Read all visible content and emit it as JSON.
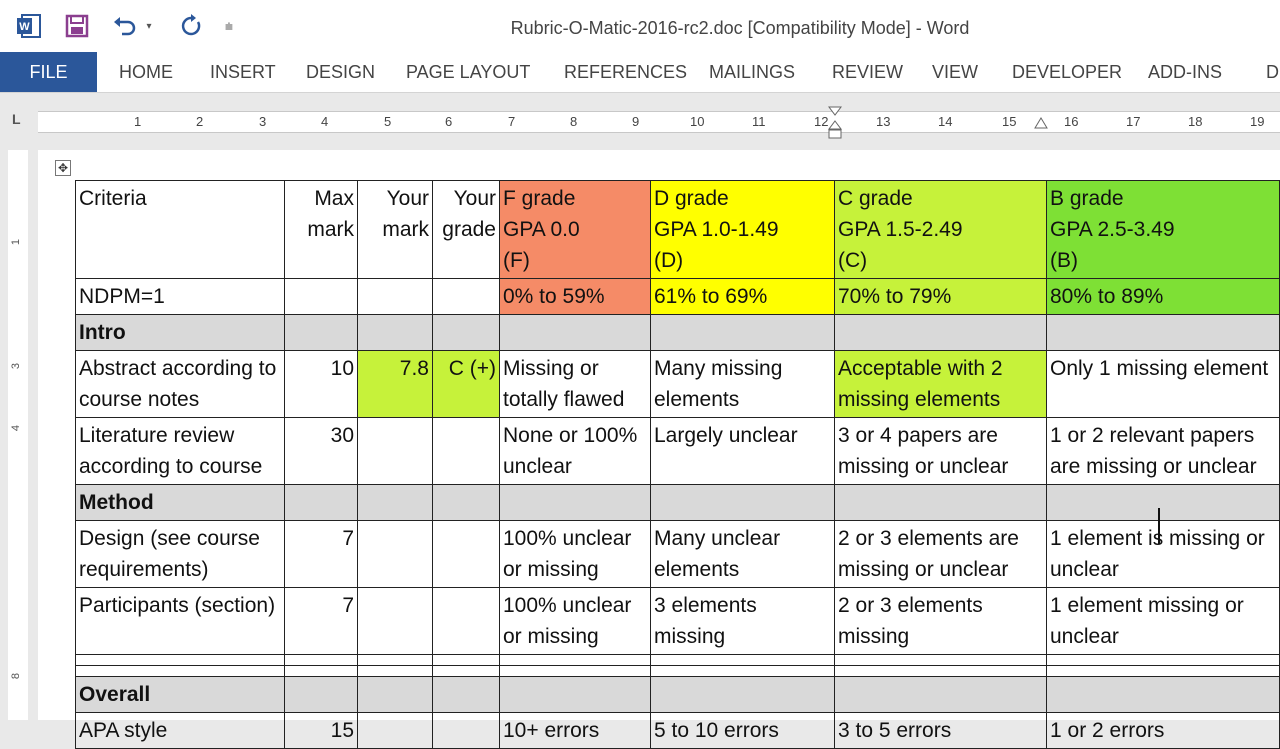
{
  "app": {
    "title": "Rubric-O-Matic-2016-rc2.doc [Compatibility Mode] - Word",
    "icons": [
      "word-icon",
      "save-icon",
      "undo-icon",
      "undo-dropdown-icon",
      "redo-icon",
      "customize-qat-icon"
    ]
  },
  "ribbon": {
    "file": "FILE",
    "tabs": [
      "HOME",
      "INSERT",
      "DESIGN",
      "PAGE LAYOUT",
      "REFERENCES",
      "MAILINGS",
      "REVIEW",
      "VIEW",
      "DEVELOPER",
      "ADD-INS",
      "D"
    ]
  },
  "ruler": {
    "tab_selector": "L",
    "numbers": [
      "1",
      "2",
      "3",
      "4",
      "5",
      "6",
      "7",
      "8",
      "9",
      "10",
      "11",
      "12",
      "13",
      "14",
      "15",
      "16",
      "17",
      "18",
      "19"
    ],
    "vertical_numbers": [
      "1",
      "3",
      "4",
      "8"
    ]
  },
  "table": {
    "header": {
      "criteria": "Criteria",
      "max_mark": [
        "Max",
        "mark"
      ],
      "your_mark": [
        "Your",
        "mark"
      ],
      "your_grade": [
        "Your",
        "grade"
      ],
      "grades": [
        {
          "lines": [
            "F grade",
            "GPA 0.0",
            "(F)"
          ],
          "range": "0% to 59%",
          "color": "#f58b67"
        },
        {
          "lines": [
            "D grade",
            "GPA 1.0-1.49",
            "(D)"
          ],
          "range": "61% to 69%",
          "color": "#ffff00"
        },
        {
          "lines": [
            "C grade",
            "GPA 1.5-2.49",
            "(C)"
          ],
          "range": "70% to 79%",
          "color": "#c6f23a"
        },
        {
          "lines": [
            "B grade",
            "GPA 2.5-3.49",
            "(B)"
          ],
          "range": "80% to 89%",
          "color": "#7ee035"
        }
      ]
    },
    "ndpm": "NDPM=1",
    "sections": {
      "intro": "Intro",
      "method": "Method",
      "overall": "Overall"
    },
    "rows": {
      "abstract": {
        "criteria": [
          "Abstract according to",
          "course notes"
        ],
        "max": "10",
        "your_mark": "7.8",
        "your_grade": "C (+)",
        "f": [
          "Missing or",
          "totally flawed"
        ],
        "d": [
          "Many missing",
          "elements"
        ],
        "c": [
          "Acceptable with 2",
          "missing elements"
        ],
        "b": [
          "Only 1 missing element",
          ""
        ]
      },
      "litreview": {
        "criteria": [
          "Literature review",
          "according to course"
        ],
        "max": "30",
        "f": [
          "None or 100%",
          "unclear"
        ],
        "d": [
          "Largely unclear",
          ""
        ],
        "c": [
          "3 or 4 papers are",
          "missing or unclear"
        ],
        "b": [
          "1 or 2 relevant papers",
          "are missing or unclear"
        ]
      },
      "design": {
        "criteria": [
          "Design (see course",
          "requirements)"
        ],
        "max": "7",
        "f": [
          "100% unclear",
          "or missing"
        ],
        "d": [
          "Many unclear",
          "elements"
        ],
        "c": [
          "2 or 3 elements are",
          "missing or unclear"
        ],
        "b": [
          "1 element is missing or",
          "unclear"
        ]
      },
      "participants": {
        "criteria": [
          "Participants (section)",
          ""
        ],
        "max": "7",
        "f": [
          "100% unclear",
          "or missing"
        ],
        "d": [
          "3 elements",
          "missing"
        ],
        "c": [
          "2 or 3 elements",
          "missing"
        ],
        "b": [
          "1 element missing or",
          "unclear"
        ]
      },
      "apa": {
        "criteria": "APA style",
        "max": "15",
        "f": "10+ errors",
        "d": "5 to 10 errors",
        "c": "3 to 5 errors",
        "b": "1 or 2 errors"
      }
    }
  }
}
